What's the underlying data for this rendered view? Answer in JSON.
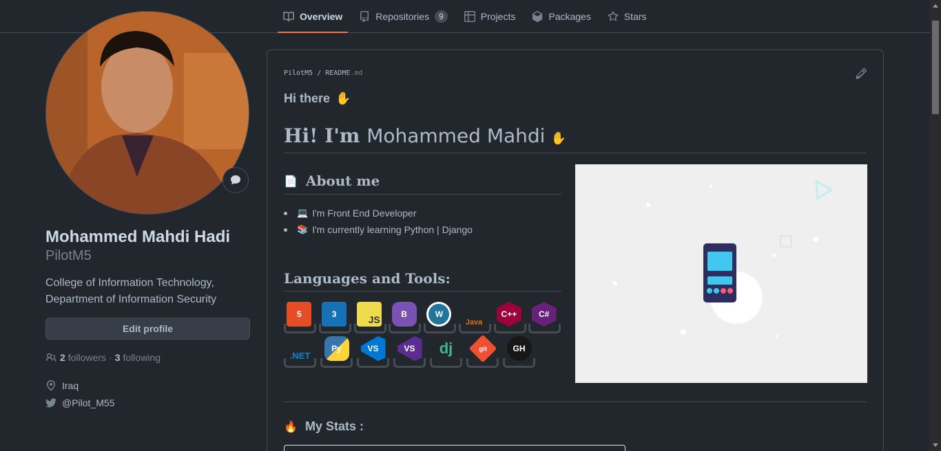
{
  "tabs": [
    {
      "label": "Overview",
      "icon": "book-icon",
      "active": true
    },
    {
      "label": "Repositories",
      "icon": "repo-icon",
      "count": "9"
    },
    {
      "label": "Projects",
      "icon": "table-icon"
    },
    {
      "label": "Packages",
      "icon": "package-icon"
    },
    {
      "label": "Stars",
      "icon": "star-icon"
    }
  ],
  "profile": {
    "fullname": "Mohammed Mahdi Hadi",
    "username": "PilotM5",
    "bio": "College of Information Technology, Department of Information Security",
    "edit_label": "Edit profile",
    "followers_count": "2",
    "followers_label": "followers",
    "following_count": "3",
    "following_label": "following",
    "location": "Iraq",
    "twitter": "@Pilot_M55"
  },
  "readme": {
    "owner": "PilotM5",
    "file": "README",
    "ext": ".md",
    "hi_there": "Hi there",
    "heading_serif": "Hi! I'm",
    "heading_name": "Mohammed Mahdi",
    "about_title": "About me",
    "bullets": [
      "I'm Front End Developer",
      "I'm currently learning Python | Django"
    ],
    "langs_title": "Languages and Tools:",
    "stats_title": "My Stats :"
  },
  "tools": [
    {
      "name": "html5",
      "label": "5",
      "color": "#e44d26"
    },
    {
      "name": "css3",
      "label": "3",
      "color": "#1572b6"
    },
    {
      "name": "javascript",
      "label": "JS",
      "color": "#f0db4f"
    },
    {
      "name": "bootstrap",
      "label": "B",
      "color": "#7952b3"
    },
    {
      "name": "wordpress",
      "label": "W",
      "color": "#21759b"
    },
    {
      "name": "java",
      "label": "Java",
      "color": "#e76f00"
    },
    {
      "name": "cplusplus",
      "label": "C++",
      "color": "#9c033a"
    },
    {
      "name": "csharp",
      "label": "C#",
      "color": "#68217a"
    },
    {
      "name": "dotnet",
      "label": ".NET",
      "color": "#1384c8"
    },
    {
      "name": "python",
      "label": "Py",
      "color": "#3776ab"
    },
    {
      "name": "vscode",
      "label": "VS",
      "color": "#0078d4"
    },
    {
      "name": "visualstudio",
      "label": "VS",
      "color": "#5c2d91"
    },
    {
      "name": "django",
      "label": "dj",
      "color": "#44b78b"
    },
    {
      "name": "git",
      "label": "git",
      "color": "#f05032"
    },
    {
      "name": "github",
      "label": "GH",
      "color": "#181717"
    }
  ]
}
